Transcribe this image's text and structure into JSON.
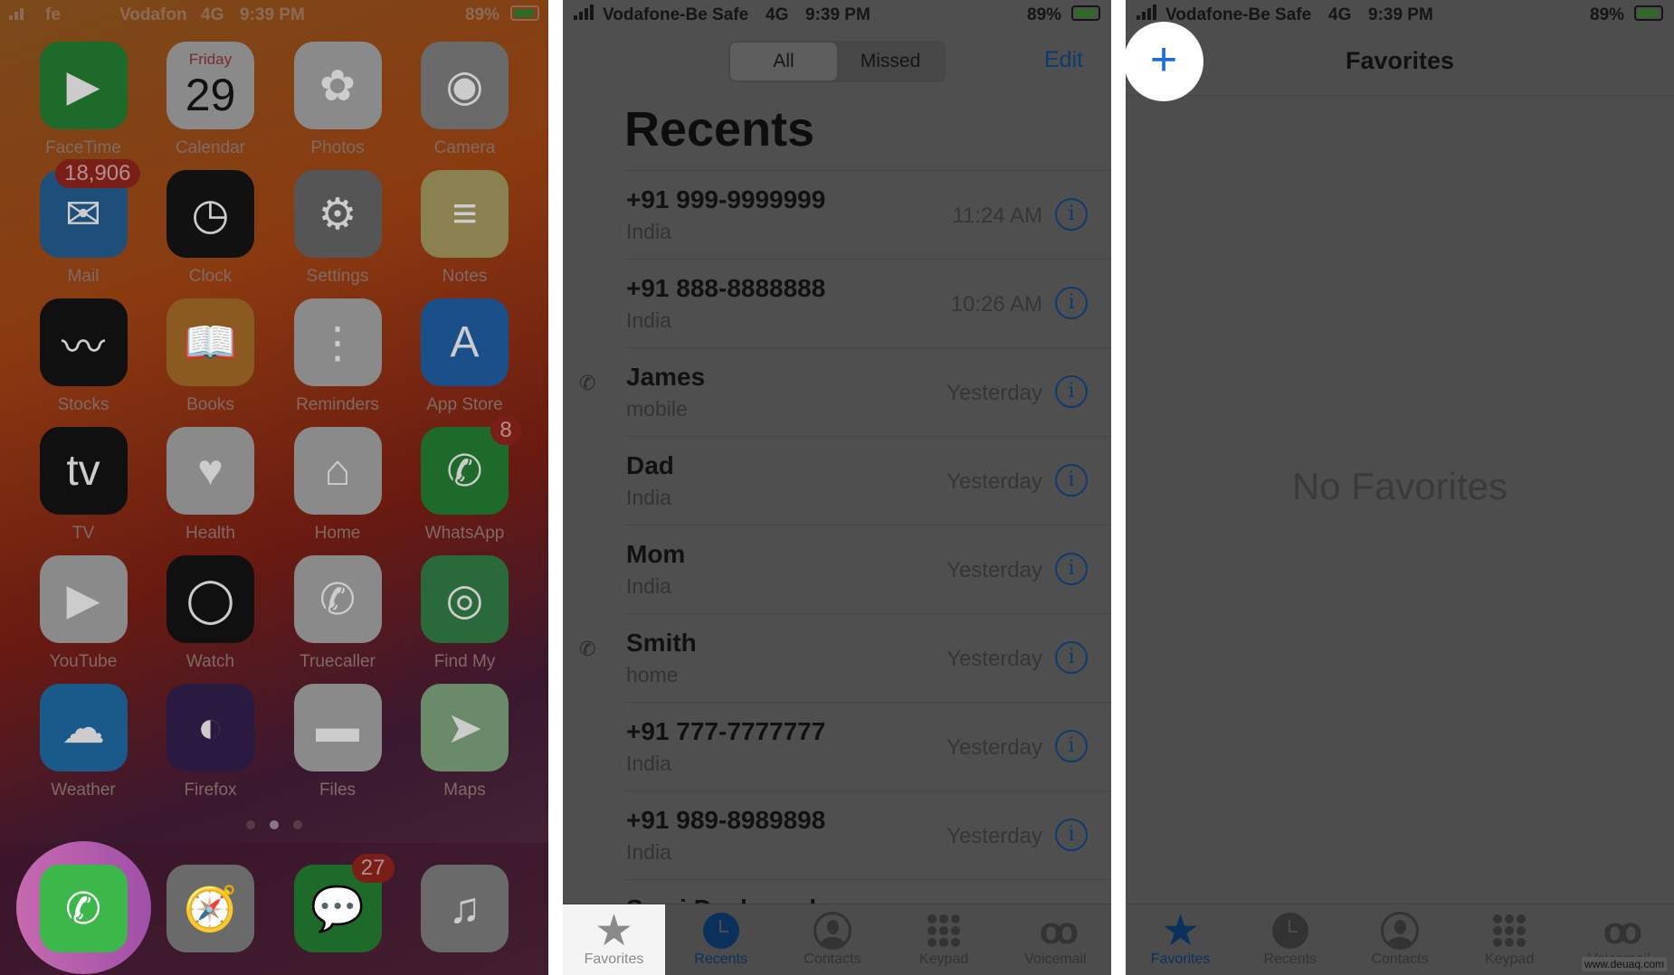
{
  "home": {
    "status": {
      "carrier": "Vodafon",
      "carrier_short": "fe",
      "network": "4G",
      "time": "9:39 PM",
      "battery": "89%"
    },
    "apps": [
      {
        "label": "FaceTime",
        "icon": "facetime-icon",
        "color": "#1e6a2a",
        "glyph": "▶"
      },
      {
        "label": "Calendar",
        "icon": "calendar-icon",
        "color": "#8a8a8a",
        "glyph": "29",
        "sub": "Friday"
      },
      {
        "label": "Photos",
        "icon": "photos-icon",
        "color": "#8a8a8a",
        "glyph": "✿"
      },
      {
        "label": "Camera",
        "icon": "camera-icon",
        "color": "#6a6a6a",
        "glyph": "◉"
      },
      {
        "label": "Mail",
        "icon": "mail-icon",
        "color": "#1d4f7a",
        "glyph": "✉",
        "badge": "18,906"
      },
      {
        "label": "Clock",
        "icon": "clock-icon",
        "color": "#111111",
        "glyph": "◷"
      },
      {
        "label": "Settings",
        "icon": "settings-icon",
        "color": "#555555",
        "glyph": "⚙"
      },
      {
        "label": "Notes",
        "icon": "notes-icon",
        "color": "#8a8050",
        "glyph": "≡"
      },
      {
        "label": "Stocks",
        "icon": "stocks-icon",
        "color": "#101010",
        "glyph": "〰"
      },
      {
        "label": "Books",
        "icon": "books-icon",
        "color": "#8a5a20",
        "glyph": "📖"
      },
      {
        "label": "Reminders",
        "icon": "reminders-icon",
        "color": "#8a8a8a",
        "glyph": "⋮"
      },
      {
        "label": "App Store",
        "icon": "app-store-icon",
        "color": "#1a4f8a",
        "glyph": "A"
      },
      {
        "label": "TV",
        "icon": "tv-icon",
        "color": "#101010",
        "glyph": "tv"
      },
      {
        "label": "Health",
        "icon": "health-icon",
        "color": "#8a8a8a",
        "glyph": "♥"
      },
      {
        "label": "Home",
        "icon": "home-icon",
        "color": "#8a8a8a",
        "glyph": "⌂"
      },
      {
        "label": "WhatsApp",
        "icon": "whatsapp-icon",
        "color": "#1e6a2a",
        "glyph": "✆",
        "badge": "8"
      },
      {
        "label": "YouTube",
        "icon": "youtube-icon",
        "color": "#8a8a8a",
        "glyph": "▶"
      },
      {
        "label": "Watch",
        "icon": "watch-icon",
        "color": "#101010",
        "glyph": "◯"
      },
      {
        "label": "Truecaller",
        "icon": "truecaller-icon",
        "color": "#8a8a8a",
        "glyph": "✆"
      },
      {
        "label": "Find My",
        "icon": "find-my-icon",
        "color": "#2a6a3a",
        "glyph": "◎"
      },
      {
        "label": "Weather",
        "icon": "weather-icon",
        "color": "#1a5a8a",
        "glyph": "☁"
      },
      {
        "label": "Firefox",
        "icon": "firefox-icon",
        "color": "#2a1a40",
        "glyph": "◐"
      },
      {
        "label": "Files",
        "icon": "files-icon",
        "color": "#8a8a8a",
        "glyph": "▬"
      },
      {
        "label": "Maps",
        "icon": "maps-icon",
        "color": "#6a8a6a",
        "glyph": "➤"
      }
    ],
    "dock": [
      {
        "icon": "phone-icon",
        "color": "#3cb84a",
        "glyph": "✆"
      },
      {
        "icon": "safari-icon",
        "color": "#6a6a6a",
        "glyph": "🧭"
      },
      {
        "icon": "messages-icon",
        "color": "#1e6a2a",
        "glyph": "💬",
        "badge": "27"
      },
      {
        "icon": "music-icon",
        "color": "#6a6a6a",
        "glyph": "♫"
      }
    ],
    "page_dots": 3,
    "page_active": 1,
    "accent_highlight": "#b45aac"
  },
  "recents": {
    "status": {
      "carrier": "Vodafone-Be Safe",
      "network": "4G",
      "time": "9:39 PM",
      "battery": "89%"
    },
    "segments": [
      "All",
      "Missed"
    ],
    "active_segment": "All",
    "edit": "Edit",
    "title": "Recents",
    "rows": [
      {
        "name": "+91 999-9999999",
        "sub": "India",
        "time": "11:24 AM"
      },
      {
        "name": "+91 888-8888888",
        "sub": "India",
        "time": "10:26 AM"
      },
      {
        "name": "James",
        "sub": "mobile",
        "time": "Yesterday",
        "outgoing": true
      },
      {
        "name": "Dad",
        "sub": "India",
        "time": "Yesterday"
      },
      {
        "name": "Mom",
        "sub": "India",
        "time": "Yesterday"
      },
      {
        "name": "Smith",
        "sub": "home",
        "time": "Yesterday",
        "outgoing": true
      },
      {
        "name": "+91 777-7777777",
        "sub": "India",
        "time": "Yesterday"
      },
      {
        "name": "+91 989-8989898",
        "sub": "India",
        "time": "Yesterday"
      },
      {
        "name": "Sami Deshpande",
        "sub": "",
        "time": ""
      }
    ],
    "tabs": [
      "Favorites",
      "Recents",
      "Contacts",
      "Keypad",
      "Voicemail"
    ],
    "selected_tab": "Recents",
    "highlighted_tab": "Favorites"
  },
  "favorites": {
    "status": {
      "carrier": "Vodafone-Be Safe",
      "network": "4G",
      "time": "9:39 PM",
      "battery": "89%"
    },
    "title": "Favorites",
    "add": "+",
    "empty": "No Favorites",
    "tabs": [
      "Favorites",
      "Recents",
      "Contacts",
      "Keypad",
      "Voicemail"
    ],
    "selected_tab": "Favorites",
    "watermark": "www.deuaq.com"
  }
}
